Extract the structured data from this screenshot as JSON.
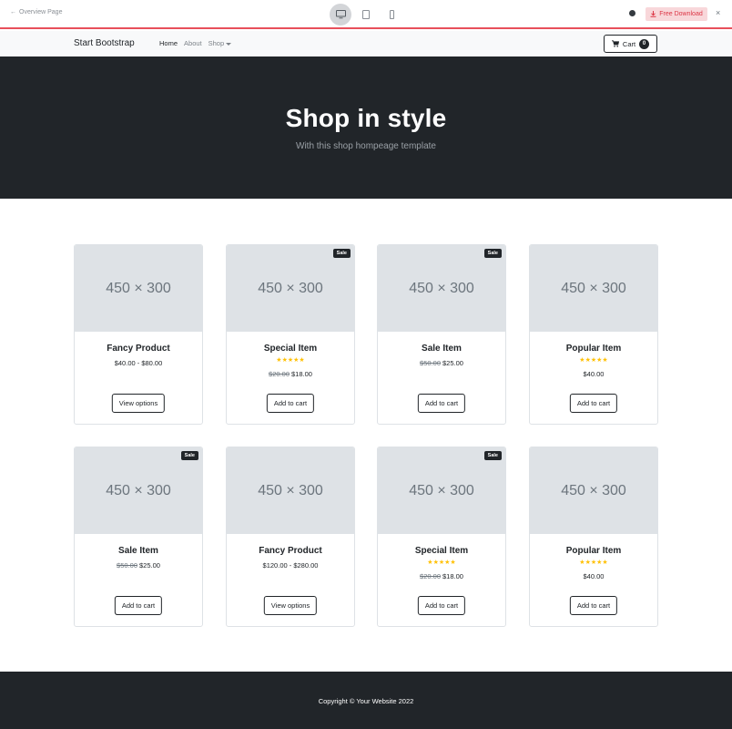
{
  "preview_bar": {
    "back_label": "Overview Page",
    "download_label": "Free Download"
  },
  "navbar": {
    "brand": "Start Bootstrap",
    "links": [
      {
        "label": "Home",
        "active": true
      },
      {
        "label": "About",
        "active": false
      },
      {
        "label": "Shop",
        "active": false,
        "dropdown": true
      }
    ],
    "cart": {
      "label": "Cart",
      "count": "0"
    }
  },
  "hero": {
    "title": "Shop in style",
    "subtitle": "With this shop hompeage template"
  },
  "products": [
    {
      "image_text": "450 × 300",
      "sale": false,
      "name": "Fancy Product",
      "stars": 0,
      "old_price": "",
      "price": "$40.00 - $80.00",
      "button": "View options"
    },
    {
      "image_text": "450 × 300",
      "sale": true,
      "sale_label": "Sale",
      "name": "Special Item",
      "stars": 5,
      "old_price": "$20.00",
      "price": "$18.00",
      "button": "Add to cart"
    },
    {
      "image_text": "450 × 300",
      "sale": true,
      "sale_label": "Sale",
      "name": "Sale Item",
      "stars": 0,
      "old_price": "$50.00",
      "price": "$25.00",
      "button": "Add to cart"
    },
    {
      "image_text": "450 × 300",
      "sale": false,
      "name": "Popular Item",
      "stars": 5,
      "old_price": "",
      "price": "$40.00",
      "button": "Add to cart"
    },
    {
      "image_text": "450 × 300",
      "sale": true,
      "sale_label": "Sale",
      "name": "Sale Item",
      "stars": 0,
      "old_price": "$50.00",
      "price": "$25.00",
      "button": "Add to cart"
    },
    {
      "image_text": "450 × 300",
      "sale": false,
      "name": "Fancy Product",
      "stars": 0,
      "old_price": "",
      "price": "$120.00 - $280.00",
      "button": "View options"
    },
    {
      "image_text": "450 × 300",
      "sale": true,
      "sale_label": "Sale",
      "name": "Special Item",
      "stars": 5,
      "old_price": "$20.00",
      "price": "$18.00",
      "button": "Add to cart"
    },
    {
      "image_text": "450 × 300",
      "sale": false,
      "name": "Popular Item",
      "stars": 5,
      "old_price": "",
      "price": "$40.00",
      "button": "Add to cart"
    }
  ],
  "footer": {
    "copyright": "Copyright © Your Website 2022"
  },
  "colors": {
    "dark": "#212529",
    "star": "#ffc107",
    "download_bg": "#f8d7da",
    "download_text": "#dc3545",
    "accent_line": "#e8505b"
  },
  "icons": {
    "back": "arrow-left-icon",
    "devices": [
      "desktop-icon",
      "tablet-icon",
      "mobile-icon"
    ],
    "github": "github-icon",
    "download": "download-icon",
    "close": "close-icon",
    "cart": "cart-icon",
    "star": "star-icon"
  }
}
